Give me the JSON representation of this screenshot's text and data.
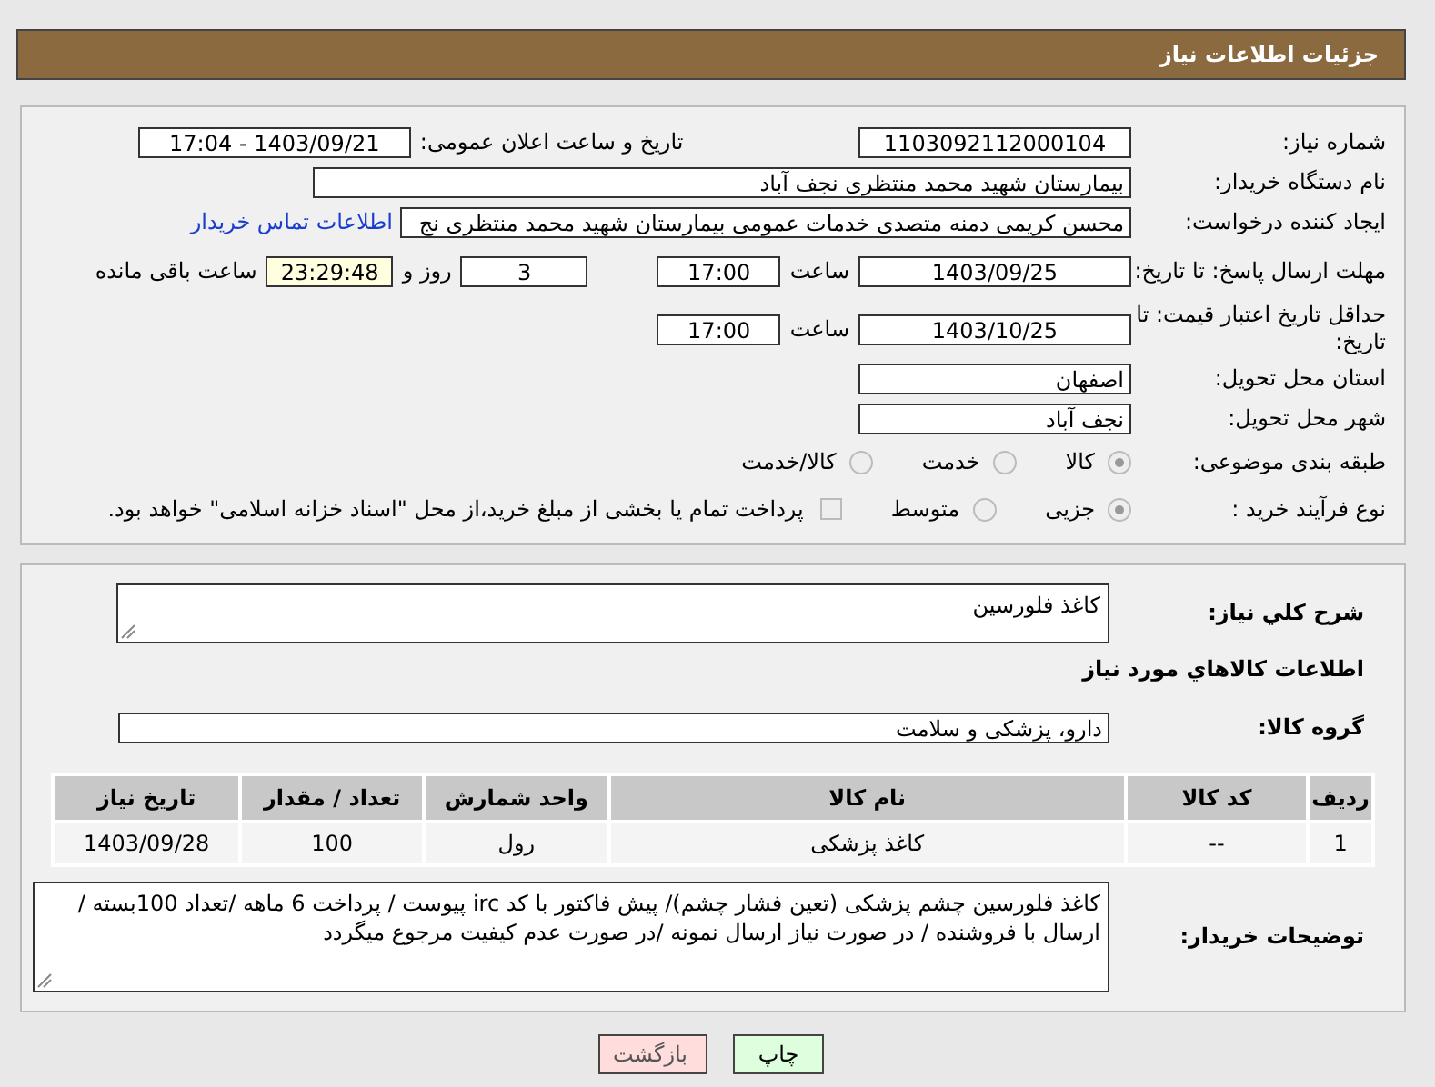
{
  "header": {
    "title": "جزئیات اطلاعات نیاز"
  },
  "need_number": {
    "label": "شماره نیاز:",
    "value": "1103092112000104"
  },
  "announce": {
    "label": "تاریخ و ساعت اعلان عمومی:",
    "value": "1403/09/21 - 17:04"
  },
  "buyer_org": {
    "label": "نام دستگاه خریدار:",
    "value": "بیمارستان شهید محمد منتظری نجف آباد"
  },
  "requester": {
    "label": "ایجاد کننده درخواست:",
    "value": "محسن کریمی دمنه متصدی خدمات عمومی بیمارستان شهید محمد منتظری نج",
    "link": "اطلاعات تماس خریدار"
  },
  "reply_deadline": {
    "label": "مهلت ارسال پاسخ: تا تاریخ:",
    "date": "1403/09/25",
    "time_label": "ساعت",
    "time": "17:00",
    "days": "3",
    "days_label": "روز و",
    "remaining": "23:29:48",
    "remaining_label": "ساعت باقی مانده"
  },
  "price_validity": {
    "label": "حداقل تاریخ اعتبار قیمت: تا تاریخ:",
    "date": "1403/10/25",
    "time_label": "ساعت",
    "time": "17:00"
  },
  "province": {
    "label": "استان محل تحویل:",
    "value": "اصفهان"
  },
  "city": {
    "label": "شهر محل تحویل:",
    "value": "نجف آباد"
  },
  "category": {
    "label": "طبقه بندی موضوعی:",
    "options": [
      {
        "label": "کالا",
        "selected": true
      },
      {
        "label": "خدمت",
        "selected": false
      },
      {
        "label": "کالا/خدمت",
        "selected": false
      }
    ]
  },
  "process": {
    "label": "نوع فرآیند خرید :",
    "options": [
      {
        "label": "جزیی",
        "selected": true
      },
      {
        "label": "متوسط",
        "selected": false
      }
    ],
    "treasury": {
      "checked": false,
      "text": "پرداخت تمام یا بخشی از مبلغ خرید،از محل \"اسناد خزانه اسلامی\" خواهد بود."
    }
  },
  "summary": {
    "label": "شرح کلي نياز:",
    "value": "کاغذ فلورسین"
  },
  "items_title": "اطلاعات کالاهاي مورد نياز",
  "group": {
    "label": "گروه کالا:",
    "value": "دارو، پزشکی و سلامت"
  },
  "table": {
    "columns": [
      "ردیف",
      "کد کالا",
      "نام کالا",
      "واحد شمارش",
      "تعداد / مقدار",
      "تاریخ نیاز"
    ],
    "rows": [
      [
        "1",
        "--",
        "کاغذ پزشکی",
        "رول",
        "100",
        "1403/09/28"
      ]
    ]
  },
  "buyer_notes": {
    "label": "توضیحات خریدار:",
    "value": "کاغذ فلورسین چشم پزشکی (تعین فشار چشم)/ پیش فاکتور با کد irc پیوست / پرداخت 6 ماهه /تعداد 100بسته / ارسال با فروشنده / در صورت نیاز ارسال نمونه /در صورت عدم کیفیت مرجوع میگردد"
  },
  "buttons": [
    {
      "label": "چاپ",
      "kind": "print"
    },
    {
      "label": "بازگشت",
      "kind": "back"
    }
  ]
}
